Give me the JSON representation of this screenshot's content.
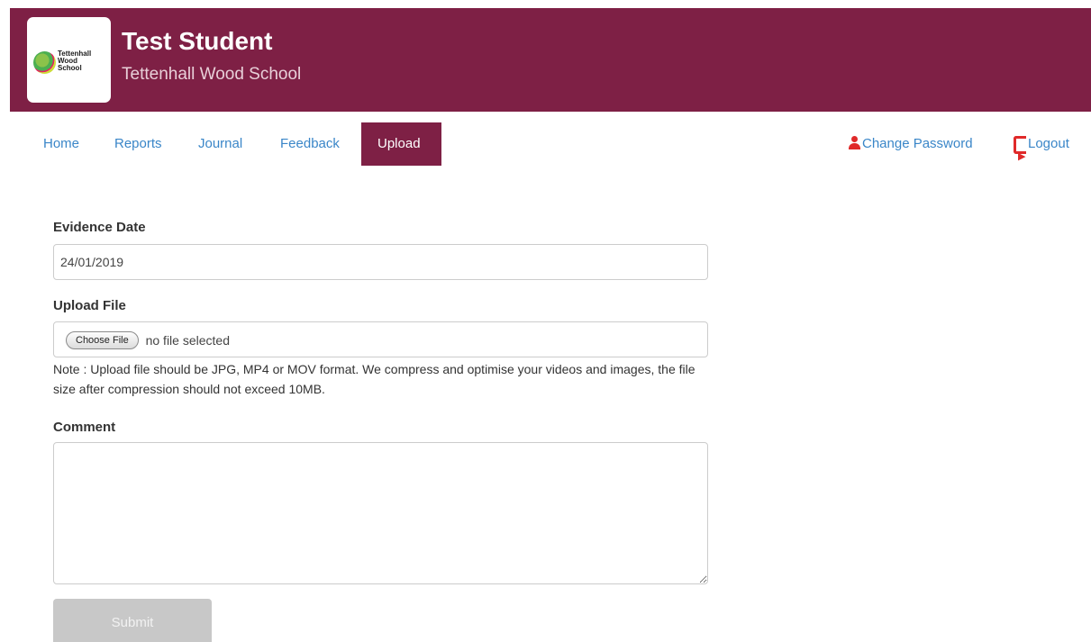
{
  "header": {
    "student_name": "Test Student",
    "school_name": "Tettenhall Wood School",
    "logo_text": [
      "Tettenhall",
      "Wood",
      "School"
    ],
    "background_color": "#7e2045"
  },
  "nav": {
    "items": [
      {
        "label": "Home",
        "active": false
      },
      {
        "label": "Reports",
        "active": false
      },
      {
        "label": "Journal",
        "active": false
      },
      {
        "label": "Feedback",
        "active": false
      },
      {
        "label": "Upload",
        "active": true
      }
    ],
    "change_password": {
      "label": "Change Password",
      "icon": "user-icon"
    },
    "logout": {
      "label": "Logout",
      "icon": "logout-icon"
    },
    "link_color": "#3a86c8",
    "icon_color": "#e02a2a"
  },
  "form": {
    "evidence_date": {
      "label": "Evidence Date",
      "value": "24/01/2019"
    },
    "upload_file": {
      "label": "Upload File",
      "button_label": "Choose File",
      "status": "no file selected",
      "note": "Note : Upload file should be JPG, MP4 or MOV format. We compress and optimise your videos and images, the file size after compression should not exceed 10MB."
    },
    "comment": {
      "label": "Comment",
      "value": ""
    },
    "submit": {
      "label": "Submit",
      "enabled": false
    }
  }
}
